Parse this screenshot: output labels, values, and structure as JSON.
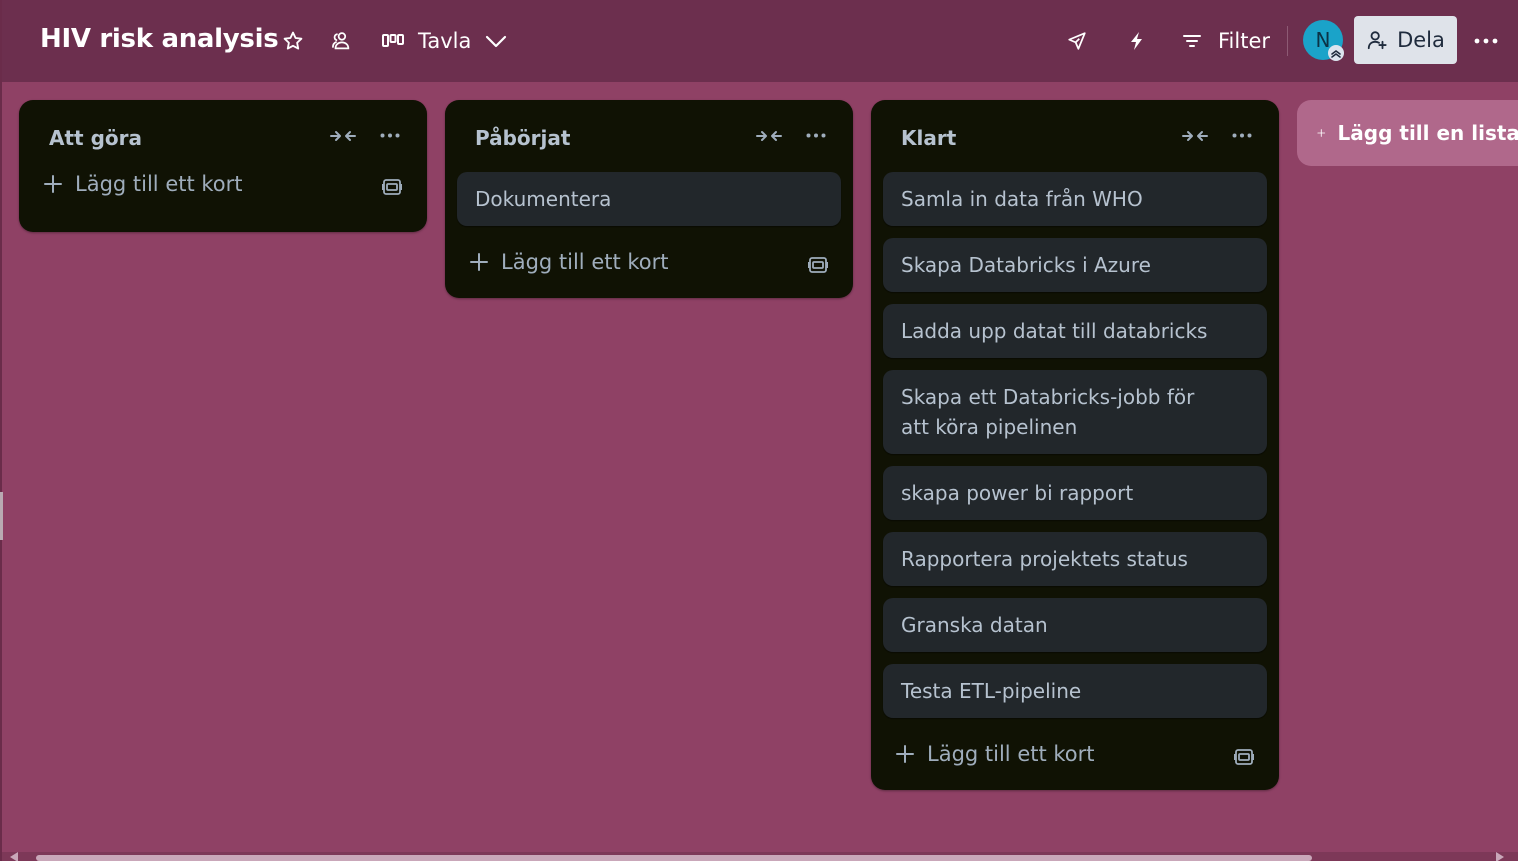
{
  "header": {
    "board_title": "HIV risk analysis",
    "view_label": "Tavla",
    "filter_label": "Filter",
    "avatar_initial": "N",
    "share_label": "Dela",
    "icons": {
      "star": "star-icon",
      "visibility": "team-visibility-icon",
      "view": "board-view-icon",
      "view_dropdown": "chevron-down-icon",
      "power_ups": "rocket-icon",
      "automation": "lightning-icon",
      "filter": "filter-icon",
      "share": "add-person-icon",
      "more": "ellipsis-icon"
    }
  },
  "colors": {
    "board_background": "#8f4165",
    "header_background": "#6c2f4e",
    "list_background": "#101204",
    "card_background": "#22272b",
    "text": "#b6c2cf",
    "avatar": "#1aa3c9",
    "share_button": "#dfe3ea",
    "add_list_background": "#b0688b"
  },
  "lists": [
    {
      "title": "Att göra",
      "cards": [],
      "add_card_label": "Lägg till ett kort"
    },
    {
      "title": "Påbörjat",
      "cards": [
        "Dokumentera"
      ],
      "add_card_label": "Lägg till ett kort"
    },
    {
      "title": "Klart",
      "cards": [
        "Samla in data från WHO",
        "Skapa Databricks i Azure",
        "Ladda upp datat till databricks",
        "Skapa ett Databricks-jobb för att köra pipelinen",
        "skapa power bi rapport",
        "Rapportera projektets status",
        "Granska datan",
        "Testa ETL-pipeline"
      ],
      "add_card_label": "Lägg till ett kort"
    }
  ],
  "add_list_label": "Lägg till en lista till"
}
